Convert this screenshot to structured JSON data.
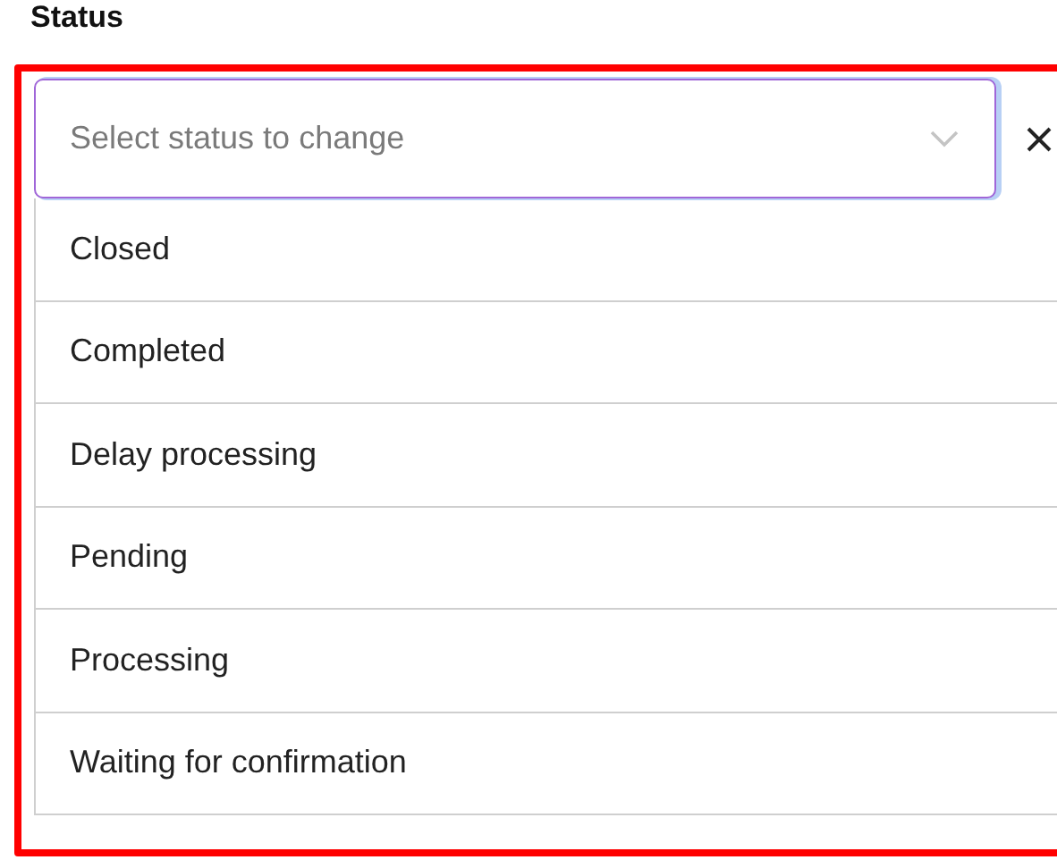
{
  "label": "Status",
  "select": {
    "placeholder": "Select status to change",
    "open": true
  },
  "options": [
    {
      "label": "Closed",
      "selected": false
    },
    {
      "label": "Completed",
      "selected": false
    },
    {
      "label": "Delay processing",
      "selected": false
    },
    {
      "label": "Pending",
      "selected": false
    },
    {
      "label": "Processing",
      "selected": false
    },
    {
      "label": "Waiting for confirmation",
      "selected": false
    }
  ]
}
